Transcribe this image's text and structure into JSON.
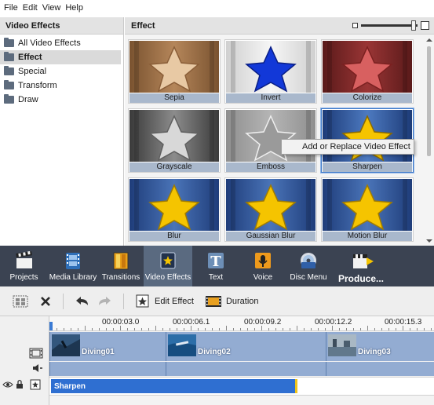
{
  "menu": [
    "File",
    "Edit",
    "View",
    "Help"
  ],
  "left_panel": {
    "title": "Video Effects",
    "items": [
      {
        "label": "All Video Effects",
        "selected": false
      },
      {
        "label": "Effect",
        "selected": true
      },
      {
        "label": "Special",
        "selected": false
      },
      {
        "label": "Transform",
        "selected": false
      },
      {
        "label": "Draw",
        "selected": false
      }
    ]
  },
  "right_panel": {
    "title": "Effect",
    "effects": [
      {
        "label": "Sepia",
        "style": "sepia"
      },
      {
        "label": "Invert",
        "style": "invert"
      },
      {
        "label": "Colorize",
        "style": "colorize"
      },
      {
        "label": "Grayscale",
        "style": "grayscale"
      },
      {
        "label": "Emboss",
        "style": "emboss"
      },
      {
        "label": "Sharpen",
        "style": "sharpen",
        "selected": true
      },
      {
        "label": "Blur",
        "style": "normal"
      },
      {
        "label": "Gaussian Blur",
        "style": "normal"
      },
      {
        "label": "Motion Blur",
        "style": "normal"
      }
    ]
  },
  "context_menu": {
    "item": "Add or Replace Video Effect"
  },
  "main_toolbar": [
    {
      "label": "Projects",
      "icon": "clapper-icon"
    },
    {
      "label": "Media Library",
      "icon": "film-icon"
    },
    {
      "label": "Transitions",
      "icon": "transitions-icon"
    },
    {
      "label": "Video Effects",
      "icon": "star-effect-icon",
      "active": true
    },
    {
      "label": "Text",
      "icon": "text-t-icon"
    },
    {
      "label": "Voice",
      "icon": "microphone-icon"
    },
    {
      "label": "Disc Menu",
      "icon": "disc-icon"
    },
    {
      "label": "Produce...",
      "icon": "produce-icon"
    }
  ],
  "edit_toolbar": {
    "edit_effect": "Edit Effect",
    "duration": "Duration"
  },
  "timeline": {
    "ruler": [
      "00:00:03.0",
      "00:00:06.1",
      "00:00:09.2",
      "00:00:12.2",
      "00:00:15.3"
    ],
    "clips": [
      "Diving01",
      "Diving02",
      "Diving03"
    ],
    "effect": "Sharpen"
  },
  "colors": {
    "toolbar_bg": "#3b4352",
    "track_bg": "#93acd2",
    "effect_bar": "#2f6fd1",
    "star_gold": "#f5c400"
  }
}
